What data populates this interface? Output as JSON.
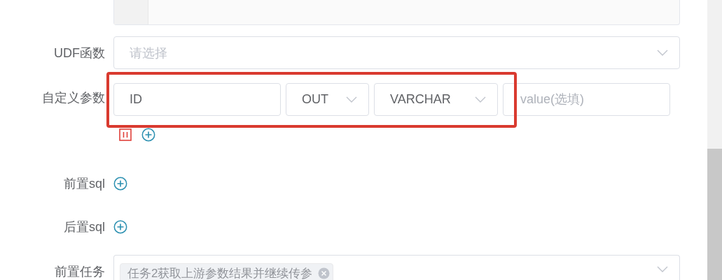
{
  "fields": [
    {
      "label": "UDF函数",
      "kind": "select",
      "placeholder": "请选择"
    },
    {
      "label": "自定义参数",
      "kind": "params",
      "highlighted": true,
      "params": [
        {
          "prop": "ID",
          "direct": "OUT",
          "type": "VARCHAR",
          "value_placeholder": "value(选填)"
        }
      ]
    },
    {
      "label": "前置sql",
      "kind": "add"
    },
    {
      "label": "后置sql",
      "kind": "add"
    },
    {
      "label": "前置任务",
      "kind": "tags",
      "tags": [
        "任务2获取上游参数结果并继续传参"
      ]
    }
  ]
}
